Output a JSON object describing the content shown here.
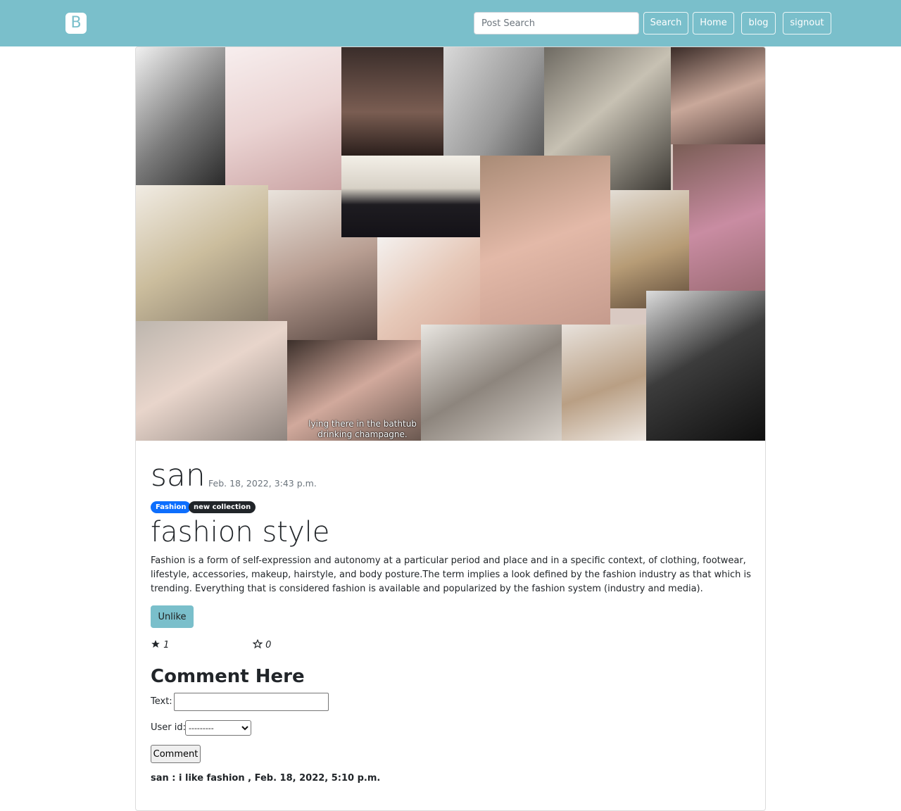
{
  "navbar": {
    "brand": "B",
    "search_placeholder": "Post Search",
    "search_label": "Search",
    "home_label": "Home",
    "blog_label": "blog",
    "signout_label": "signout",
    "background_color": "#7abfcb"
  },
  "post": {
    "author": "san",
    "date": "Feb. 18, 2022, 3:43 p.m.",
    "tags": [
      "Fashion",
      "new collection"
    ],
    "title": "fashion style",
    "body": "Fashion is a form of self-expression and autonomy at a particular period and place and in a specific context, of clothing, footwear, lifestyle, accessories, makeup, hairstyle, and body posture.The term implies a look defined by the fashion industry as that which is trending. Everything that is considered fashion is available and popularized by the fashion system (industry and media).",
    "image_caption": "lying there in the bathtub drinking champagne.",
    "unlike_label": "Unlike",
    "like_count": "1",
    "dislike_count": "0"
  },
  "comment_form": {
    "heading": "Comment Here",
    "text_label": "Text:",
    "user_label": "User id:",
    "user_selected": "---------",
    "submit_label": "Comment"
  },
  "comments": [
    {
      "text": "san : i like fashion , Feb. 18, 2022, 5:10 p.m."
    }
  ]
}
